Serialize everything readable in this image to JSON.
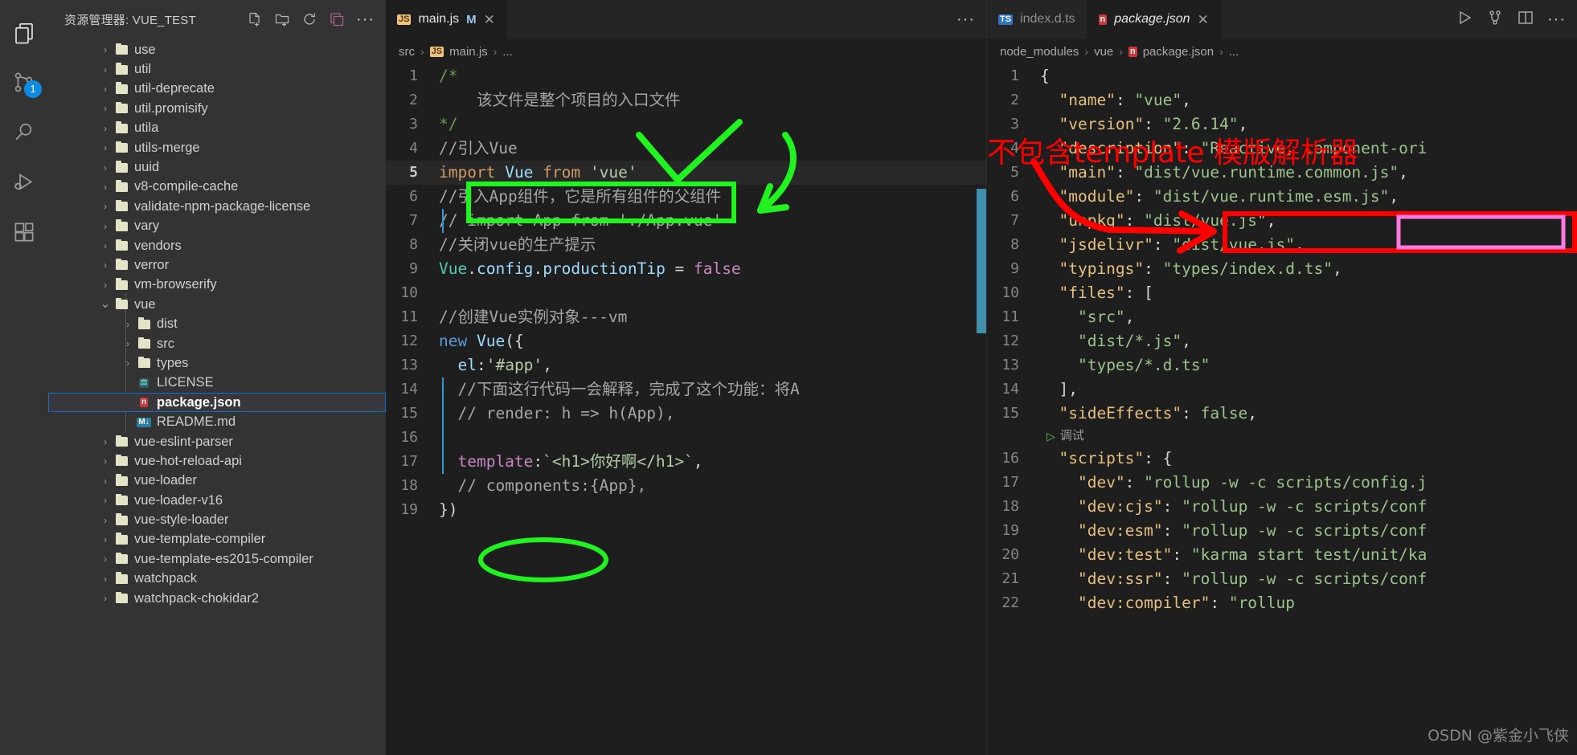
{
  "activity_bar": {
    "items": [
      {
        "name": "explorer",
        "icon": "files-icon",
        "badge": ""
      },
      {
        "name": "source-control",
        "icon": "source-control-icon",
        "badge": "1"
      },
      {
        "name": "search",
        "icon": "search-icon",
        "badge": ""
      },
      {
        "name": "run-debug",
        "icon": "run-debug-icon",
        "badge": ""
      },
      {
        "name": "extensions",
        "icon": "extensions-icon",
        "badge": ""
      }
    ]
  },
  "sidebar": {
    "title": "资源管理器: VUE_TEST",
    "actions": [
      "new-file-icon",
      "new-folder-icon",
      "refresh-icon",
      "collapse-all-icon",
      "more-actions-icon"
    ],
    "tree": [
      {
        "label": "use",
        "type": "folder",
        "depth": 1,
        "expanded": false
      },
      {
        "label": "util",
        "type": "folder",
        "depth": 1,
        "expanded": false
      },
      {
        "label": "util-deprecate",
        "type": "folder",
        "depth": 1,
        "expanded": false
      },
      {
        "label": "util.promisify",
        "type": "folder",
        "depth": 1,
        "expanded": false
      },
      {
        "label": "utila",
        "type": "folder",
        "depth": 1,
        "expanded": false
      },
      {
        "label": "utils-merge",
        "type": "folder",
        "depth": 1,
        "expanded": false
      },
      {
        "label": "uuid",
        "type": "folder",
        "depth": 1,
        "expanded": false
      },
      {
        "label": "v8-compile-cache",
        "type": "folder",
        "depth": 1,
        "expanded": false
      },
      {
        "label": "validate-npm-package-license",
        "type": "folder",
        "depth": 1,
        "expanded": false
      },
      {
        "label": "vary",
        "type": "folder",
        "depth": 1,
        "expanded": false
      },
      {
        "label": "vendors",
        "type": "folder",
        "depth": 1,
        "expanded": false
      },
      {
        "label": "verror",
        "type": "folder",
        "depth": 1,
        "expanded": false
      },
      {
        "label": "vm-browserify",
        "type": "folder",
        "depth": 1,
        "expanded": false
      },
      {
        "label": "vue",
        "type": "folder",
        "depth": 1,
        "expanded": true
      },
      {
        "label": "dist",
        "type": "folder",
        "depth": 2,
        "expanded": false
      },
      {
        "label": "src",
        "type": "folder",
        "depth": 2,
        "expanded": false
      },
      {
        "label": "types",
        "type": "folder",
        "depth": 2,
        "expanded": false
      },
      {
        "label": "LICENSE",
        "type": "file",
        "depth": 2,
        "icon": "license-file-icon",
        "icon_text": "⚖",
        "icon_bg": "#2d5f63",
        "icon_fg": "#76d0d8"
      },
      {
        "label": "package.json",
        "type": "file",
        "depth": 2,
        "selected": true,
        "icon": "npm-file-icon",
        "icon_text": "n",
        "icon_bg": "#cb3837",
        "icon_fg": "#ffffff"
      },
      {
        "label": "README.md",
        "type": "file",
        "depth": 2,
        "icon": "markdown-file-icon",
        "icon_text": "M↓",
        "icon_bg": "#2e7d9e",
        "icon_fg": "#ffffff"
      },
      {
        "label": "vue-eslint-parser",
        "type": "folder",
        "depth": 1,
        "expanded": false
      },
      {
        "label": "vue-hot-reload-api",
        "type": "folder",
        "depth": 1,
        "expanded": false
      },
      {
        "label": "vue-loader",
        "type": "folder",
        "depth": 1,
        "expanded": false
      },
      {
        "label": "vue-loader-v16",
        "type": "folder",
        "depth": 1,
        "expanded": false
      },
      {
        "label": "vue-style-loader",
        "type": "folder",
        "depth": 1,
        "expanded": false
      },
      {
        "label": "vue-template-compiler",
        "type": "folder",
        "depth": 1,
        "expanded": false
      },
      {
        "label": "vue-template-es2015-compiler",
        "type": "folder",
        "depth": 1,
        "expanded": false
      },
      {
        "label": "watchpack",
        "type": "folder",
        "depth": 1,
        "expanded": false
      },
      {
        "label": "watchpack-chokidar2",
        "type": "folder",
        "depth": 1,
        "expanded": false
      }
    ]
  },
  "editor_group_left": {
    "tabs": [
      {
        "label": "main.js",
        "icon": "js-file-icon",
        "icon_text": "JS",
        "icon_bg": "#f1c27d",
        "icon_fg": "#4a3a14",
        "modified_marker": "M",
        "close": "✕",
        "active": true,
        "italic": false
      }
    ],
    "more_actions": "···",
    "breadcrumb": [
      "src",
      "main.js",
      "..."
    ],
    "breadcrumb_icon_text": "JS",
    "language": "javascript",
    "lines": [
      {
        "n": "1",
        "tokens": [
          {
            "t": "/*",
            "c": "c-com"
          }
        ]
      },
      {
        "n": "2",
        "tokens": [
          {
            "t": "    该文件是整个项目的入口文件",
            "c": "c-comg"
          }
        ]
      },
      {
        "n": "3",
        "tokens": [
          {
            "t": "*/",
            "c": "c-com"
          }
        ]
      },
      {
        "n": "4",
        "tokens": [
          {
            "t": "//引入Vue",
            "c": "c-comg"
          }
        ]
      },
      {
        "n": "5",
        "highlight": true,
        "current": true,
        "tokens": [
          {
            "t": "import",
            "c": "c-orange"
          },
          {
            "t": " ",
            "c": "c-plain"
          },
          {
            "t": "Vue",
            "c": "c-id"
          },
          {
            "t": " ",
            "c": "c-plain"
          },
          {
            "t": "from",
            "c": "c-orange"
          },
          {
            "t": " ",
            "c": "c-plain"
          },
          {
            "t": "'vue'",
            "c": "c-strg"
          }
        ]
      },
      {
        "n": "6",
        "tokens": [
          {
            "t": "//引入App组件，它是所有组件的父组件",
            "c": "c-comg"
          }
        ]
      },
      {
        "n": "7",
        "tokens": [
          {
            "t": "// import App from './App.vue'",
            "c": "c-comg"
          }
        ]
      },
      {
        "n": "8",
        "tokens": [
          {
            "t": "//关闭vue的生产提示",
            "c": "c-comg"
          }
        ]
      },
      {
        "n": "9",
        "tokens": [
          {
            "t": "Vue",
            "c": "c-type"
          },
          {
            "t": ".",
            "c": "c-punc"
          },
          {
            "t": "config",
            "c": "c-id"
          },
          {
            "t": ".",
            "c": "c-punc"
          },
          {
            "t": "productionTip",
            "c": "c-id"
          },
          {
            "t": " = ",
            "c": "c-plain"
          },
          {
            "t": "false",
            "c": "c-kw"
          }
        ]
      },
      {
        "n": "10",
        "tokens": []
      },
      {
        "n": "11",
        "tokens": [
          {
            "t": "//创建Vue实例对象---vm",
            "c": "c-comg"
          }
        ]
      },
      {
        "n": "12",
        "tokens": [
          {
            "t": "new",
            "c": "c-kw2"
          },
          {
            "t": " ",
            "c": "c-plain"
          },
          {
            "t": "Vue",
            "c": "c-id"
          },
          {
            "t": "({",
            "c": "c-punc"
          }
        ]
      },
      {
        "n": "13",
        "tokens": [
          {
            "t": "  ",
            "c": "c-plain"
          },
          {
            "t": "el",
            "c": "c-id"
          },
          {
            "t": ":",
            "c": "c-punc"
          },
          {
            "t": "'#app'",
            "c": "c-strg"
          },
          {
            "t": ",",
            "c": "c-punc"
          }
        ]
      },
      {
        "n": "14",
        "tokens": [
          {
            "t": "  //下面这行代码一会解释，完成了这个功能：将A",
            "c": "c-comg"
          }
        ]
      },
      {
        "n": "15",
        "tokens": [
          {
            "t": "  // render: h => h(App),",
            "c": "c-comg"
          }
        ]
      },
      {
        "n": "16",
        "tokens": []
      },
      {
        "n": "17",
        "tokens": [
          {
            "t": "  ",
            "c": "c-plain"
          },
          {
            "t": "template",
            "c": "c-mag"
          },
          {
            "t": ":",
            "c": "c-punc"
          },
          {
            "t": "`<h1>你好啊</h1>`",
            "c": "c-strg"
          },
          {
            "t": ",",
            "c": "c-punc"
          }
        ]
      },
      {
        "n": "18",
        "tokens": [
          {
            "t": "  // components:{App},",
            "c": "c-comg"
          }
        ]
      },
      {
        "n": "19",
        "tokens": [
          {
            "t": "})",
            "c": "c-punc"
          }
        ]
      }
    ]
  },
  "editor_group_right": {
    "tabs": [
      {
        "label": "index.d.ts",
        "icon": "ts-file-icon",
        "icon_text": "TS",
        "icon_bg": "#2f74c0",
        "icon_fg": "#ffffff",
        "active": false,
        "italic": false
      },
      {
        "label": "package.json",
        "icon": "npm-file-icon",
        "icon_text": "n",
        "icon_bg": "#cb3837",
        "icon_fg": "#ffffff",
        "active": true,
        "italic": true,
        "close": "✕"
      }
    ],
    "actions": [
      "run-icon",
      "fork-icon",
      "split-editor-icon",
      "more-actions-icon"
    ],
    "breadcrumb": [
      "node_modules",
      "vue",
      "package.json",
      "..."
    ],
    "breadcrumb_icon_text": "n",
    "lines": [
      {
        "n": "1",
        "tokens": [
          {
            "t": "{",
            "c": "c-punc"
          }
        ]
      },
      {
        "n": "2",
        "tokens": [
          {
            "t": "  ",
            "c": "c-plain"
          },
          {
            "t": "\"name\"",
            "c": "c-json-k"
          },
          {
            "t": ": ",
            "c": "c-punc"
          },
          {
            "t": "\"vue\"",
            "c": "c-json-v"
          },
          {
            "t": ",",
            "c": "c-punc"
          }
        ]
      },
      {
        "n": "3",
        "tokens": [
          {
            "t": "  ",
            "c": "c-plain"
          },
          {
            "t": "\"version\"",
            "c": "c-json-k"
          },
          {
            "t": ": ",
            "c": "c-punc"
          },
          {
            "t": "\"2.6.14\"",
            "c": "c-json-v"
          },
          {
            "t": ",",
            "c": "c-punc"
          }
        ]
      },
      {
        "n": "4",
        "tokens": [
          {
            "t": "  ",
            "c": "c-plain"
          },
          {
            "t": "\"description\"",
            "c": "c-json-k"
          },
          {
            "t": ": ",
            "c": "c-punc"
          },
          {
            "t": "\"Reactive, component-ori",
            "c": "c-json-v"
          }
        ]
      },
      {
        "n": "5",
        "tokens": [
          {
            "t": "  ",
            "c": "c-plain"
          },
          {
            "t": "\"main\"",
            "c": "c-json-k"
          },
          {
            "t": ": ",
            "c": "c-punc"
          },
          {
            "t": "\"dist/vue.runtime.common.js\"",
            "c": "c-json-v"
          },
          {
            "t": ",",
            "c": "c-punc"
          }
        ]
      },
      {
        "n": "6",
        "tokens": [
          {
            "t": "  ",
            "c": "c-plain"
          },
          {
            "t": "\"module\"",
            "c": "c-json-k"
          },
          {
            "t": ": ",
            "c": "c-punc"
          },
          {
            "t": "\"dist/vue.runtime.esm.js\"",
            "c": "c-json-v"
          },
          {
            "t": ",",
            "c": "c-punc"
          }
        ]
      },
      {
        "n": "7",
        "tokens": [
          {
            "t": "  ",
            "c": "c-plain"
          },
          {
            "t": "\"unpkg\"",
            "c": "c-json-k"
          },
          {
            "t": ": ",
            "c": "c-punc"
          },
          {
            "t": "\"dist/vue.js\"",
            "c": "c-json-v"
          },
          {
            "t": ",",
            "c": "c-punc"
          }
        ]
      },
      {
        "n": "8",
        "tokens": [
          {
            "t": "  ",
            "c": "c-plain"
          },
          {
            "t": "\"jsdelivr\"",
            "c": "c-json-k"
          },
          {
            "t": ": ",
            "c": "c-punc"
          },
          {
            "t": "\"dist/vue.js\"",
            "c": "c-json-v"
          },
          {
            "t": ",",
            "c": "c-punc"
          }
        ]
      },
      {
        "n": "9",
        "tokens": [
          {
            "t": "  ",
            "c": "c-plain"
          },
          {
            "t": "\"typings\"",
            "c": "c-json-k"
          },
          {
            "t": ": ",
            "c": "c-punc"
          },
          {
            "t": "\"types/index.d.ts\"",
            "c": "c-json-v"
          },
          {
            "t": ",",
            "c": "c-punc"
          }
        ]
      },
      {
        "n": "10",
        "tokens": [
          {
            "t": "  ",
            "c": "c-plain"
          },
          {
            "t": "\"files\"",
            "c": "c-json-k"
          },
          {
            "t": ": [",
            "c": "c-punc"
          }
        ]
      },
      {
        "n": "11",
        "tokens": [
          {
            "t": "    ",
            "c": "c-plain"
          },
          {
            "t": "\"src\"",
            "c": "c-json-v"
          },
          {
            "t": ",",
            "c": "c-punc"
          }
        ]
      },
      {
        "n": "12",
        "tokens": [
          {
            "t": "    ",
            "c": "c-plain"
          },
          {
            "t": "\"dist/*.js\"",
            "c": "c-json-v"
          },
          {
            "t": ",",
            "c": "c-punc"
          }
        ]
      },
      {
        "n": "13",
        "tokens": [
          {
            "t": "    ",
            "c": "c-plain"
          },
          {
            "t": "\"types/*.d.ts\"",
            "c": "c-json-v"
          }
        ]
      },
      {
        "n": "14",
        "tokens": [
          {
            "t": "  ],",
            "c": "c-punc"
          }
        ]
      },
      {
        "n": "15",
        "tokens": [
          {
            "t": "  ",
            "c": "c-plain"
          },
          {
            "t": "\"sideEffects\"",
            "c": "c-json-k"
          },
          {
            "t": ": ",
            "c": "c-punc"
          },
          {
            "t": "false",
            "c": "c-json-v"
          },
          {
            "t": ",",
            "c": "c-punc"
          }
        ]
      },
      {
        "n": "",
        "codelens": "调试",
        "codelens_icon": "play-icon"
      },
      {
        "n": "16",
        "tokens": [
          {
            "t": "  ",
            "c": "c-plain"
          },
          {
            "t": "\"scripts\"",
            "c": "c-json-k"
          },
          {
            "t": ": {",
            "c": "c-punc"
          }
        ]
      },
      {
        "n": "17",
        "tokens": [
          {
            "t": "    ",
            "c": "c-plain"
          },
          {
            "t": "\"dev\"",
            "c": "c-json-k"
          },
          {
            "t": ": ",
            "c": "c-punc"
          },
          {
            "t": "\"rollup -w -c scripts/config.j",
            "c": "c-json-v"
          }
        ]
      },
      {
        "n": "18",
        "tokens": [
          {
            "t": "    ",
            "c": "c-plain"
          },
          {
            "t": "\"dev:cjs\"",
            "c": "c-json-k"
          },
          {
            "t": ": ",
            "c": "c-punc"
          },
          {
            "t": "\"rollup -w -c scripts/conf",
            "c": "c-json-v"
          }
        ]
      },
      {
        "n": "19",
        "tokens": [
          {
            "t": "    ",
            "c": "c-plain"
          },
          {
            "t": "\"dev:esm\"",
            "c": "c-json-k"
          },
          {
            "t": ": ",
            "c": "c-punc"
          },
          {
            "t": "\"rollup -w -c scripts/conf",
            "c": "c-json-v"
          }
        ]
      },
      {
        "n": "20",
        "tokens": [
          {
            "t": "    ",
            "c": "c-plain"
          },
          {
            "t": "\"dev:test\"",
            "c": "c-json-k"
          },
          {
            "t": ": ",
            "c": "c-punc"
          },
          {
            "t": "\"karma start test/unit/ka",
            "c": "c-json-v"
          }
        ]
      },
      {
        "n": "21",
        "tokens": [
          {
            "t": "    ",
            "c": "c-plain"
          },
          {
            "t": "\"dev:ssr\"",
            "c": "c-json-k"
          },
          {
            "t": ": ",
            "c": "c-punc"
          },
          {
            "t": "\"rollup -w -c scripts/conf",
            "c": "c-json-v"
          }
        ]
      },
      {
        "n": "22",
        "tokens": [
          {
            "t": "    ",
            "c": "c-plain"
          },
          {
            "t": "\"dev:compiler\"",
            "c": "c-json-k"
          },
          {
            "t": ": ",
            "c": "c-punc"
          },
          {
            "t": "\"rollup ",
            "c": "c-json-v"
          }
        ]
      }
    ]
  },
  "annotations": {
    "red_note": "不包含template 模版解析器",
    "colors": {
      "green": "#21f321",
      "red": "#ff0000",
      "pink": "#ff7ae0",
      "accent_blue": "#0e8ce5"
    },
    "shapes": [
      {
        "name": "green-box-import-line",
        "type": "rect",
        "color": "#21f321"
      },
      {
        "name": "green-check-mark",
        "type": "check",
        "color": "#21f321"
      },
      {
        "name": "green-arrow-curved",
        "type": "arrow",
        "color": "#21f321"
      },
      {
        "name": "green-ellipse-template",
        "type": "ellipse",
        "color": "#21f321"
      },
      {
        "name": "red-box-module-line",
        "type": "rect",
        "color": "#ff0000"
      },
      {
        "name": "red-arrow-to-module",
        "type": "arrow",
        "color": "#ff0000"
      },
      {
        "name": "pink-box-esm-filename",
        "type": "rect",
        "color": "#ff7ae0"
      }
    ]
  },
  "watermark": "OSDN @紫金小飞侠"
}
